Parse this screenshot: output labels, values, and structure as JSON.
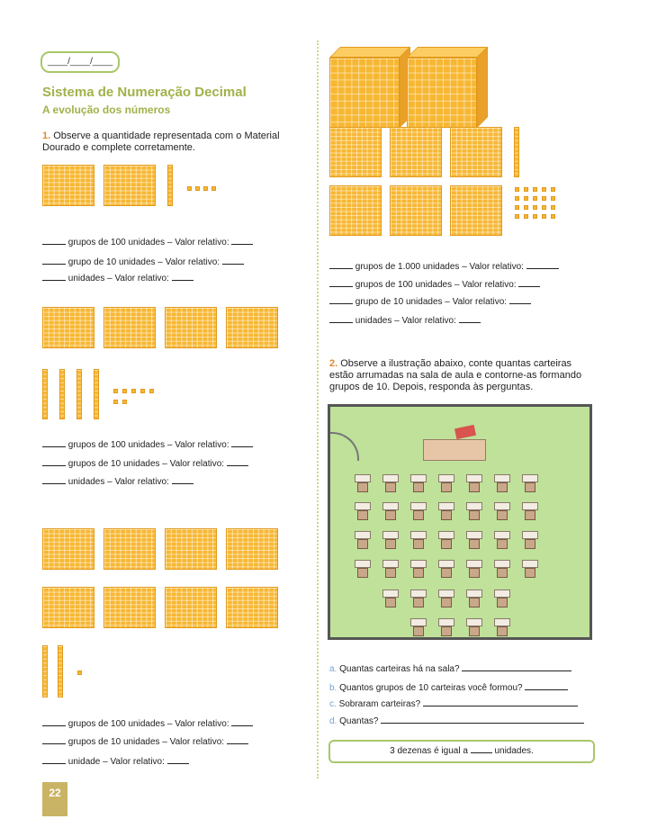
{
  "header": {
    "date_placeholder": "____/____/____",
    "title": "Sistema de Numeração Decimal",
    "subtitle": "A evolução dos números"
  },
  "exercise1": {
    "number": "1.",
    "instruction": "Observe a quantidade representada com o Material Dourado e complete corretamente.",
    "group_a": {
      "flats": 2,
      "rods": 1,
      "units": 4,
      "lines": [
        "grupos de 100 unidades – Valor relativo:",
        "grupo de 10 unidades – Valor relativo:",
        "unidades – Valor relativo:"
      ]
    },
    "group_b": {
      "flats": 4,
      "rods": 4,
      "units": 7,
      "lines": [
        "grupos de 100 unidades – Valor relativo:",
        "grupos de 10 unidades – Valor relativo:",
        "unidades – Valor relativo:"
      ]
    },
    "group_c": {
      "flats": 8,
      "rods": 2,
      "units": 1,
      "lines": [
        "grupos de 100 unidades – Valor relativo:",
        "grupos de 10 unidades – Valor relativo:",
        "unidade – Valor relativo:"
      ]
    },
    "group_d": {
      "cubes": 2,
      "flats": 6,
      "rods": 1,
      "units": 20,
      "lines": [
        "grupos de 1.000 unidades – Valor relativo:",
        "grupos de 100 unidades – Valor relativo:",
        "grupo de 10 unidades – Valor relativo:",
        "unidades – Valor relativo:"
      ]
    }
  },
  "exercise2": {
    "number": "2.",
    "instruction": "Observe a ilustração abaixo, conte quantas carteiras estão arrumadas na sala de aula e contorne-as formando grupos de 10. Depois, responda às perguntas.",
    "desk_rows": [
      7,
      7,
      7,
      7,
      5,
      4
    ],
    "questions": [
      {
        "letter": "a.",
        "text": "Quantas carteiras há na sala?"
      },
      {
        "letter": "b.",
        "text": "Quantos grupos de 10 carteiras você formou?"
      },
      {
        "letter": "c.",
        "text": "Sobraram carteiras?"
      },
      {
        "letter": "d.",
        "text": "Quantas?"
      }
    ],
    "note_before": "3 dezenas é igual a",
    "note_after": "unidades."
  },
  "footer": {
    "page_number": "22"
  },
  "colors": {
    "accent_green": "#a0b24a",
    "block_orange": "#f7b733",
    "room_green": "#bfe19a",
    "question_blue": "#6fa3d9"
  }
}
